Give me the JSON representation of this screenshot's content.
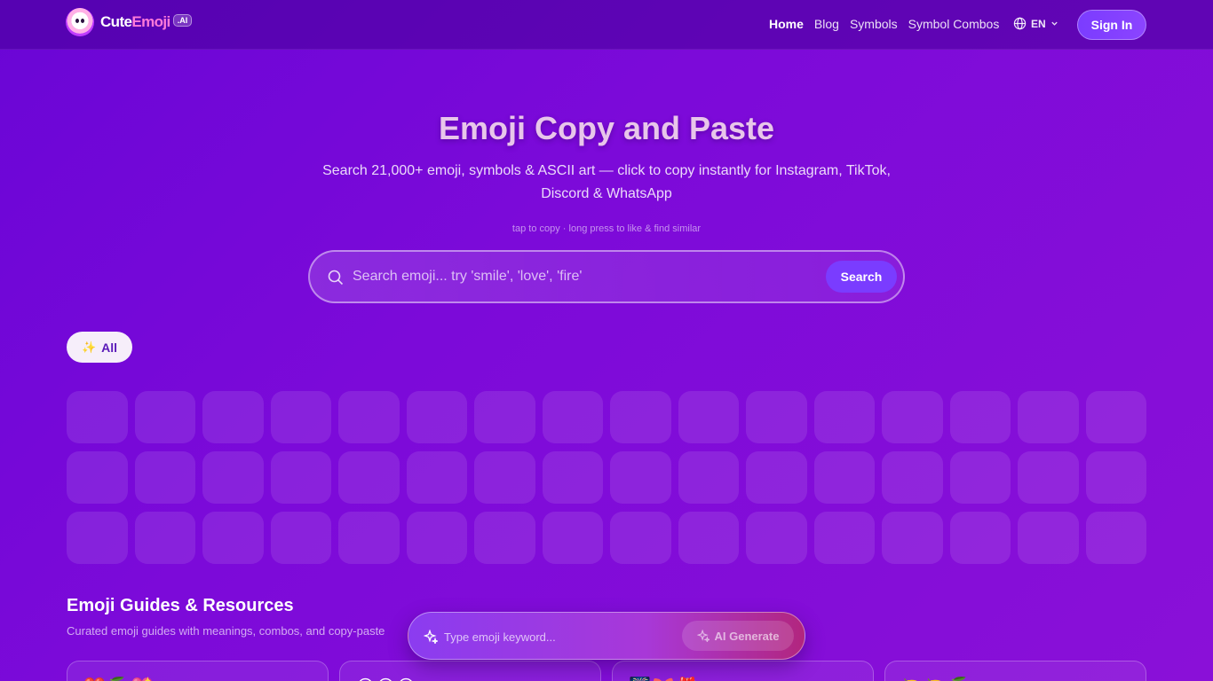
{
  "brand": {
    "name_part1": "Cute",
    "name_part2": "Emoji",
    "badge": ".AI"
  },
  "nav": {
    "links": [
      {
        "label": "Home",
        "active": true
      },
      {
        "label": "Blog",
        "active": false
      },
      {
        "label": "Symbols",
        "active": false
      },
      {
        "label": "Symbol Combos",
        "active": false
      }
    ],
    "language": "EN",
    "signin_label": "Sign In"
  },
  "hero": {
    "title": "Emoji Copy and Paste",
    "subtitle": "Search 21,000+ emoji, symbols & ASCII art — click to copy instantly for Instagram, TikTok, Discord & WhatsApp",
    "hint": "tap to copy · long press to like & find similar"
  },
  "search": {
    "placeholder": "Search emoji... try 'smile', 'love', 'fire'",
    "value": "",
    "button_label": "Search"
  },
  "filters": {
    "selected_label": "All",
    "selected_icon": "sparkles-icon"
  },
  "emoji_grid": {
    "state": "loading"
  },
  "guides": {
    "title": "Emoji Guides & Resources",
    "subtitle": "Curated emoji guides with meanings, combos, and copy-paste",
    "cards": [
      {
        "preview": "❤️🍒💖"
      },
      {
        "preview": "😊😁😆"
      },
      {
        "preview": "🎆🎀🎁"
      },
      {
        "preview": "🍋🍋🍒"
      }
    ]
  },
  "ai_bar": {
    "placeholder": "Type emoji keyword...",
    "value": "",
    "button_label": "AI Generate"
  },
  "colors": {
    "background": "#7a08d8",
    "accent": "#7a3cff",
    "brand_pink": "#ff7ad9"
  }
}
